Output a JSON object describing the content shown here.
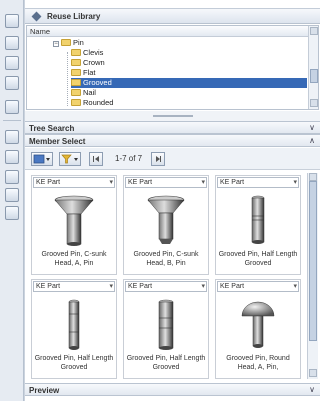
{
  "panel": {
    "title": "Reuse Library"
  },
  "tree": {
    "column_header": "Name",
    "items": [
      {
        "label": "Pin"
      },
      {
        "label": "Clevis"
      },
      {
        "label": "Crown"
      },
      {
        "label": "Flat"
      },
      {
        "label": "Grooved"
      },
      {
        "label": "Nail"
      },
      {
        "label": "Rounded"
      }
    ],
    "selected": "Grooved"
  },
  "sections": {
    "tree_search": "Tree Search",
    "member_select": "Member Select",
    "preview": "Preview"
  },
  "toolbar": {
    "page_info": "1-7 of 7"
  },
  "members": [
    {
      "type": "KE Part",
      "caption": "Grooved Pin, C-sunk Head, A, Pin",
      "icon": "countersunk-pin-icon"
    },
    {
      "type": "KE Part",
      "caption": "Grooved Pin, C-sunk Head, B, Pin",
      "icon": "countersunk-pin-icon"
    },
    {
      "type": "KE Part",
      "caption": "Grooved Pin, Half Length Grooved",
      "icon": "cylindrical-pin-icon"
    },
    {
      "type": "KE Part",
      "caption": "Grooved Pin, Half Length Grooved",
      "icon": "cylindrical-pin-icon"
    },
    {
      "type": "KE Part",
      "caption": "Grooved Pin, Half Length Grooved",
      "icon": "cylindrical-pin-icon"
    },
    {
      "type": "KE Part",
      "caption": "Grooved Pin, Round Head, A, Pin,",
      "icon": "round-head-pin-icon"
    }
  ]
}
